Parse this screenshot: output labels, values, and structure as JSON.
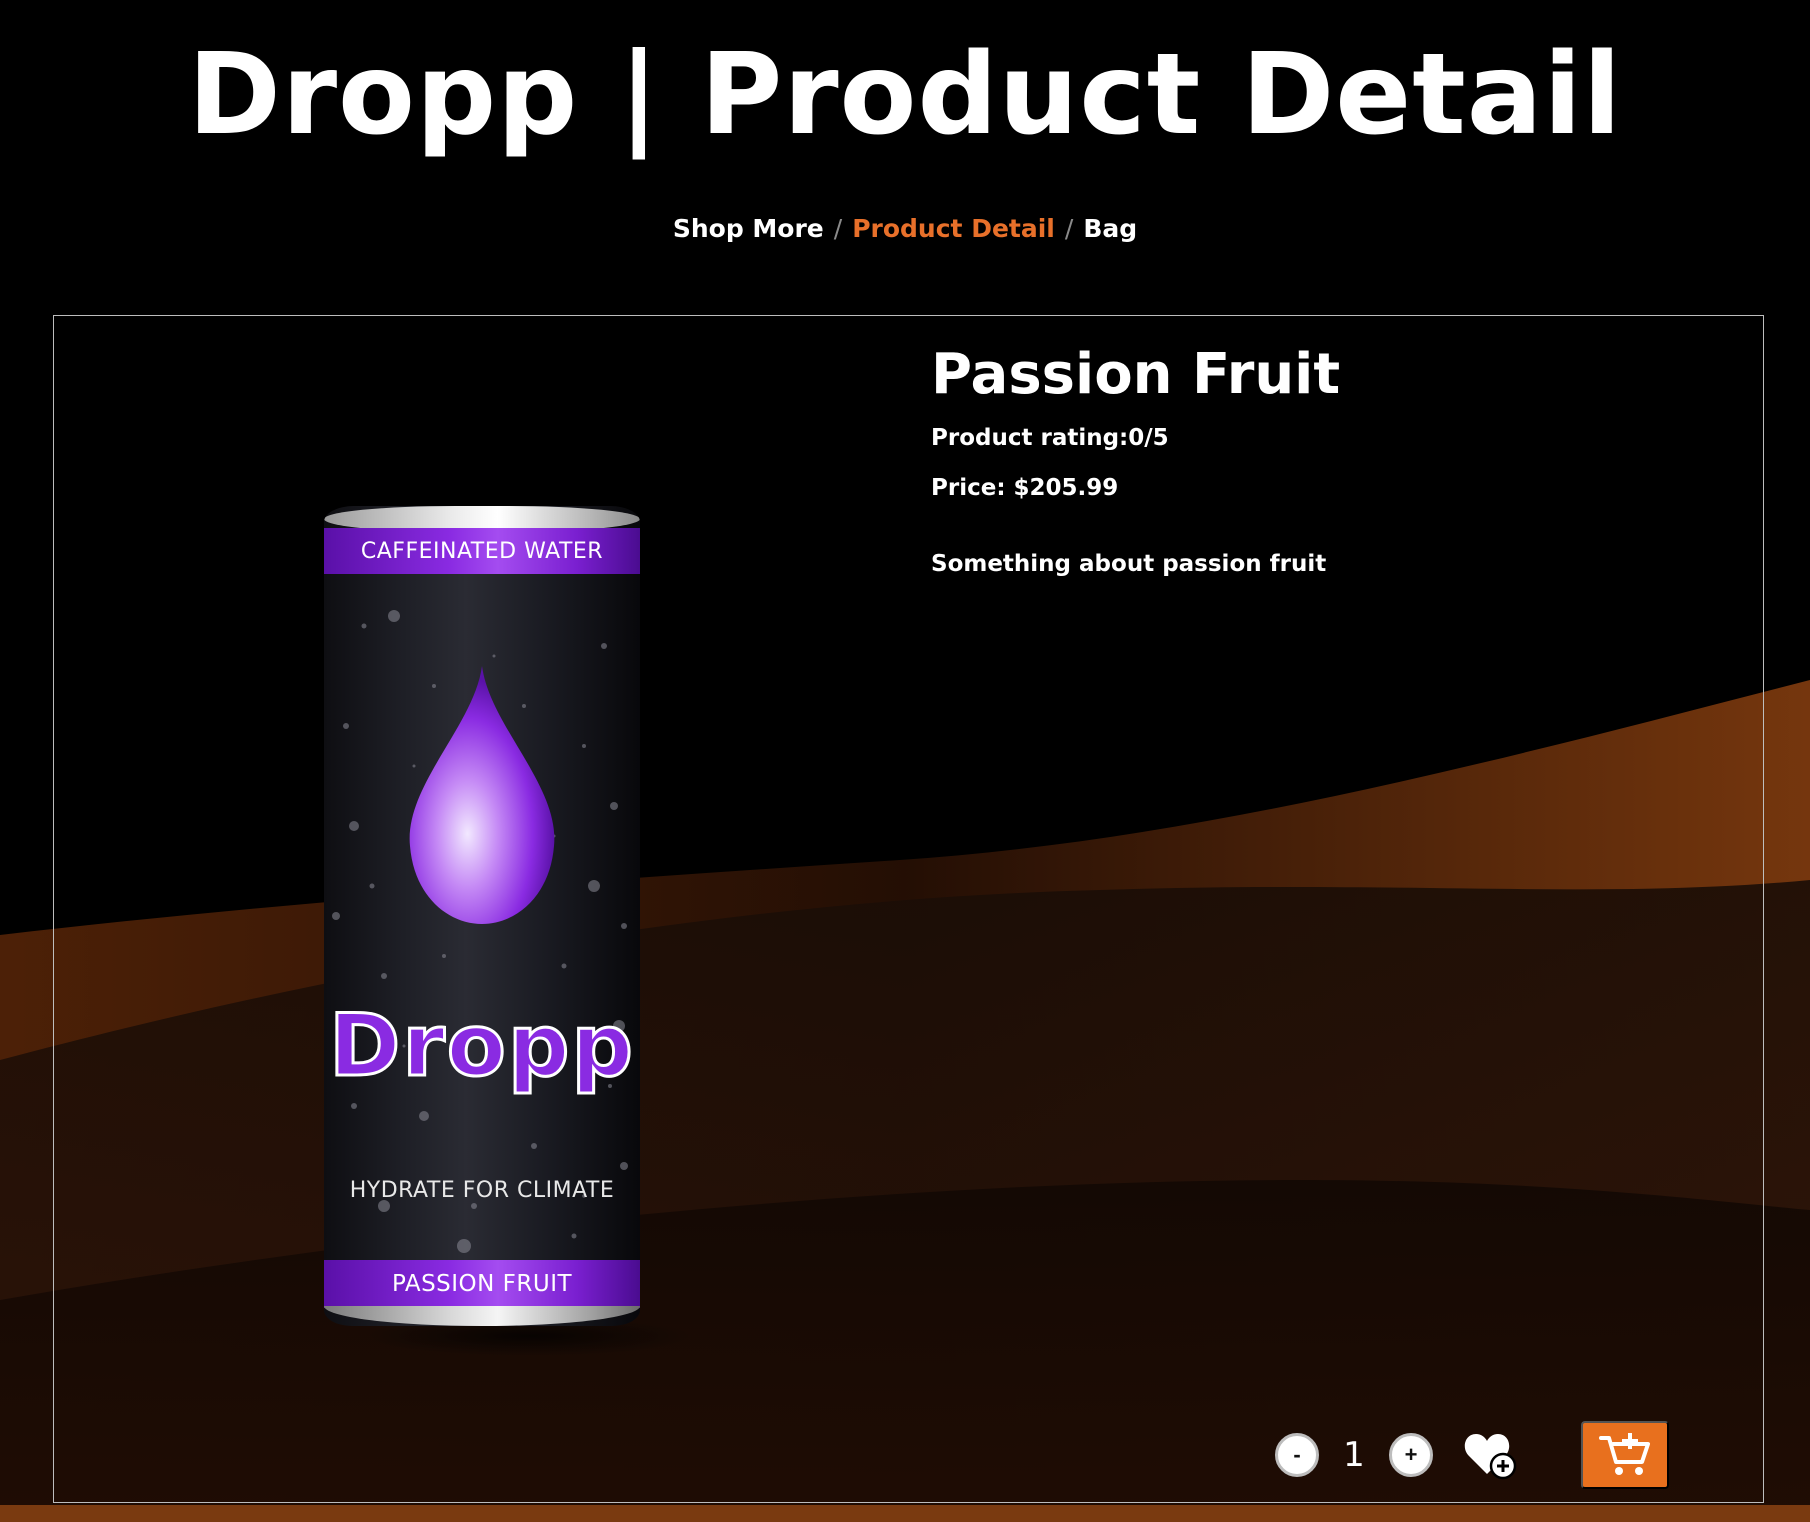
{
  "page": {
    "title": "Dropp | Product Detail"
  },
  "breadcrumb": {
    "items": [
      {
        "label": "Shop More",
        "active": false
      },
      {
        "label": "Product Detail",
        "active": true
      },
      {
        "label": "Bag",
        "active": false
      }
    ],
    "separator": "/"
  },
  "product": {
    "name": "Passion Fruit",
    "rating_text": "Product rating:0/5",
    "price_text": "Price: $205.99",
    "description": "Something about passion fruit",
    "image": {
      "top_band": "CAFFEINATED WATER",
      "brand": "Dropp",
      "tagline": "HYDRATE FOR CLIMATE",
      "bottom_band": "PASSION FRUIT"
    }
  },
  "actions": {
    "decrement_label": "-",
    "quantity": "1",
    "increment_label": "+",
    "wishlist_icon": "heart-plus-icon",
    "cart_icon": "cart-plus-icon"
  },
  "colors": {
    "accent": "#e8702a",
    "cart_button": "#e8701e",
    "can_purple": "#8a2be2",
    "background": "#000000",
    "wave": "#7a3a10"
  }
}
